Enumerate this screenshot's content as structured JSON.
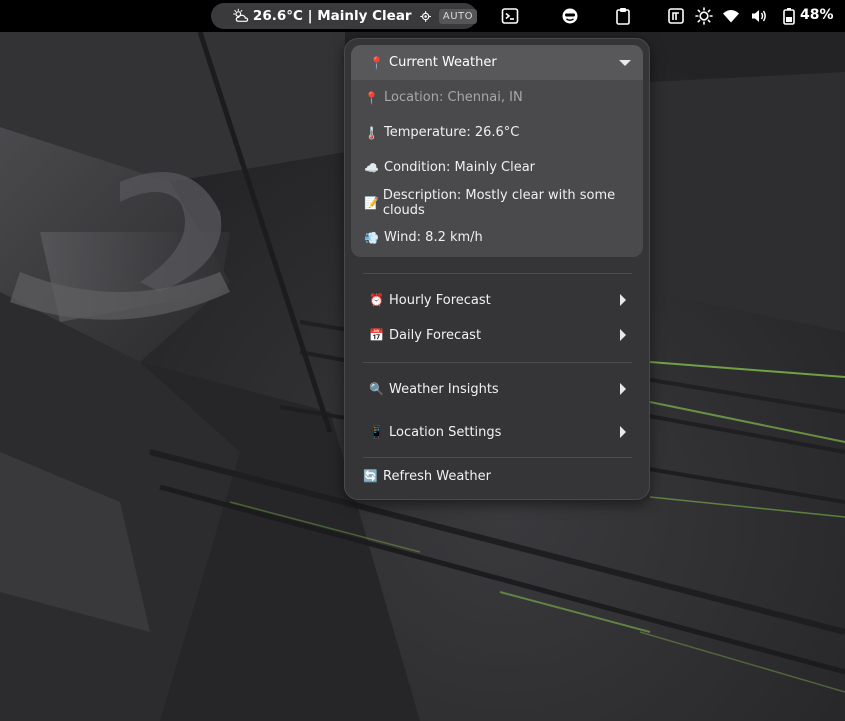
{
  "topbar": {
    "weather_text": "26.6°C | Mainly Clear",
    "auto_badge": "AUTO",
    "battery_text": "48%",
    "icons": [
      "partly-cloudy-icon",
      "locate-icon",
      "terminal-icon",
      "face-icon",
      "clipboard-icon",
      "keyboard-icon",
      "brightness-icon",
      "wifi-icon",
      "volume-icon",
      "battery-icon"
    ]
  },
  "menu": {
    "current": {
      "header_icon": "📍",
      "header_label": "Current Weather",
      "items": [
        {
          "icon": "📍",
          "label": "Location: Chennai, IN"
        },
        {
          "icon": "🌡️",
          "label": "Temperature: 26.6°C"
        },
        {
          "icon": "☁️",
          "label": "Condition: Mainly Clear"
        },
        {
          "icon": "📝",
          "label": "Description: Mostly clear with some clouds"
        },
        {
          "icon": "💨",
          "label": "Wind: 8.2 km/h"
        }
      ]
    },
    "hourly": {
      "icon": "⏰",
      "label": "Hourly Forecast"
    },
    "daily": {
      "icon": "📅",
      "label": "Daily Forecast"
    },
    "insights": {
      "icon": "🔍",
      "label": "Weather Insights"
    },
    "location_settings": {
      "icon": "📱",
      "label": "Location Settings"
    },
    "refresh": {
      "icon": "🔄",
      "label": "Refresh Weather"
    }
  },
  "colors": {
    "topbar_bg": "#000000",
    "menu_bg": "#353537",
    "submenu_bg": "#4a4a4c",
    "wallpaper_accent": "#8fd14f"
  }
}
